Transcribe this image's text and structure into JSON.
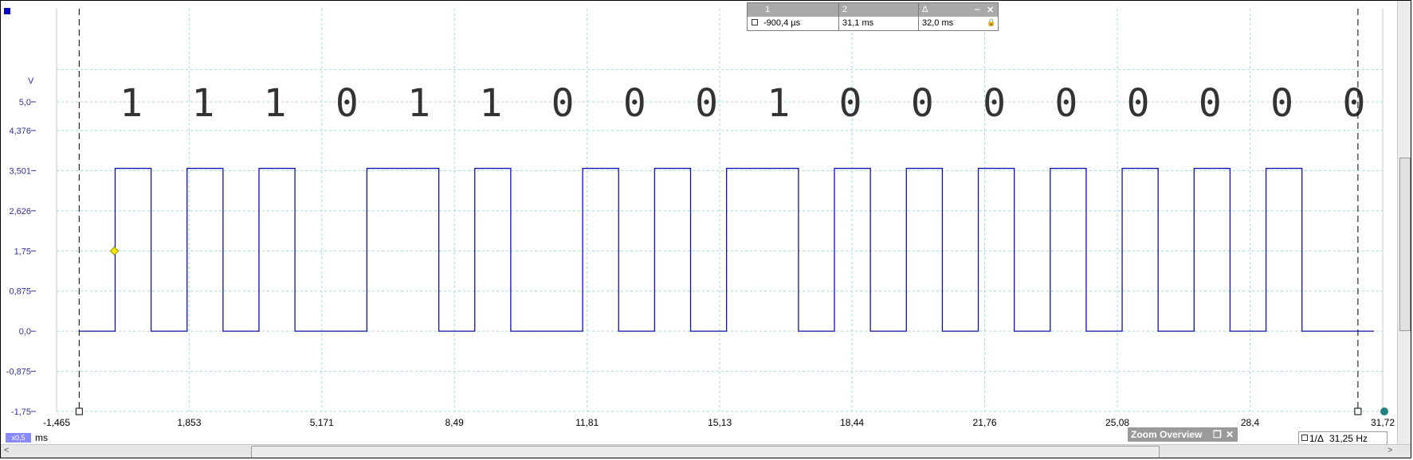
{
  "chart_data": {
    "type": "line",
    "y_unit": "V",
    "x_unit": "ms",
    "y_ticks": [
      "5,0",
      "4,376",
      "3,501",
      "2,626",
      "1,75",
      "0,875",
      "0,0",
      "-0,875",
      "-1,75"
    ],
    "y_tick_values": [
      5.0,
      4.376,
      3.501,
      2.626,
      1.75,
      0.875,
      0.0,
      -0.875,
      -1.75
    ],
    "x_ticks": [
      "-1,465",
      "1,853",
      "5,171",
      "8,49",
      "11,81",
      "15,13",
      "18,44",
      "21,76",
      "25,08",
      "28,4",
      "31,72"
    ],
    "x_tick_values": [
      -1.465,
      1.853,
      5.171,
      8.49,
      11.81,
      15.13,
      18.44,
      21.76,
      25.08,
      28.4,
      31.72
    ],
    "xlim": [
      -1.465,
      31.72
    ],
    "ylim": [
      -1.75,
      5.0
    ],
    "high_level": 3.55,
    "low_level": 0.0,
    "series": [
      {
        "color": "#1010b0",
        "segments_ms": [
          [
            -0.9,
            0.0
          ],
          [
            0.0,
            0.9
          ],
          [
            0.9,
            1.8
          ],
          [
            1.8,
            2.7
          ],
          [
            2.7,
            3.6
          ],
          [
            3.6,
            4.5
          ],
          [
            4.5,
            6.3
          ],
          [
            6.3,
            8.1
          ],
          [
            8.1,
            9.0
          ],
          [
            9.0,
            9.9
          ],
          [
            9.9,
            11.7
          ],
          [
            11.7,
            12.6
          ],
          [
            12.6,
            13.5
          ],
          [
            13.5,
            14.4
          ],
          [
            14.4,
            15.3
          ],
          [
            15.3,
            17.1
          ],
          [
            17.1,
            18.0
          ],
          [
            18.0,
            18.9
          ],
          [
            18.9,
            19.8
          ],
          [
            19.8,
            20.7
          ],
          [
            20.7,
            21.6
          ],
          [
            21.6,
            22.5
          ],
          [
            22.5,
            23.4
          ],
          [
            23.4,
            24.3
          ],
          [
            24.3,
            25.2
          ],
          [
            25.2,
            26.1
          ],
          [
            26.1,
            27.0
          ],
          [
            27.0,
            27.9
          ],
          [
            27.9,
            28.8
          ],
          [
            28.8,
            29.7
          ],
          [
            29.7,
            30.6
          ],
          [
            30.6,
            31.5
          ]
        ],
        "levels": [
          0,
          1,
          0,
          1,
          0,
          1,
          0,
          1,
          0,
          1,
          0,
          1,
          0,
          1,
          0,
          1,
          0,
          1,
          0,
          1,
          0,
          1,
          0,
          1,
          0,
          1,
          0,
          1,
          0,
          1,
          0,
          0
        ]
      }
    ],
    "bits": [
      "1",
      "1",
      "1",
      "0",
      "1",
      "1",
      "0",
      "0",
      "0",
      "1",
      "0",
      "0",
      "0",
      "0",
      "0",
      "0",
      "0",
      "0"
    ]
  },
  "ruler_table": {
    "col1_header": "1",
    "col2_header": "2",
    "col3_header": "Δ",
    "ruler1_value": "-900,4 µs",
    "ruler2_value": "31,1 ms",
    "delta_value": "32,0 ms",
    "minimize_glyph": "‒",
    "close_glyph": "✕"
  },
  "zoom_overview": {
    "title": "Zoom Overview",
    "restore_glyph": "❐",
    "close_glyph": "✕"
  },
  "freq_readout": {
    "label": "1/Δ",
    "value": "31,25 Hz"
  },
  "zoom_badge": "x0,5",
  "x_unit_label": "ms",
  "colors": {
    "trace": "#1010b0",
    "grid": "#9fd8e6",
    "axis_text": "#3030a0",
    "ruler": "#000000",
    "trigger_marker": "#f2e600"
  }
}
